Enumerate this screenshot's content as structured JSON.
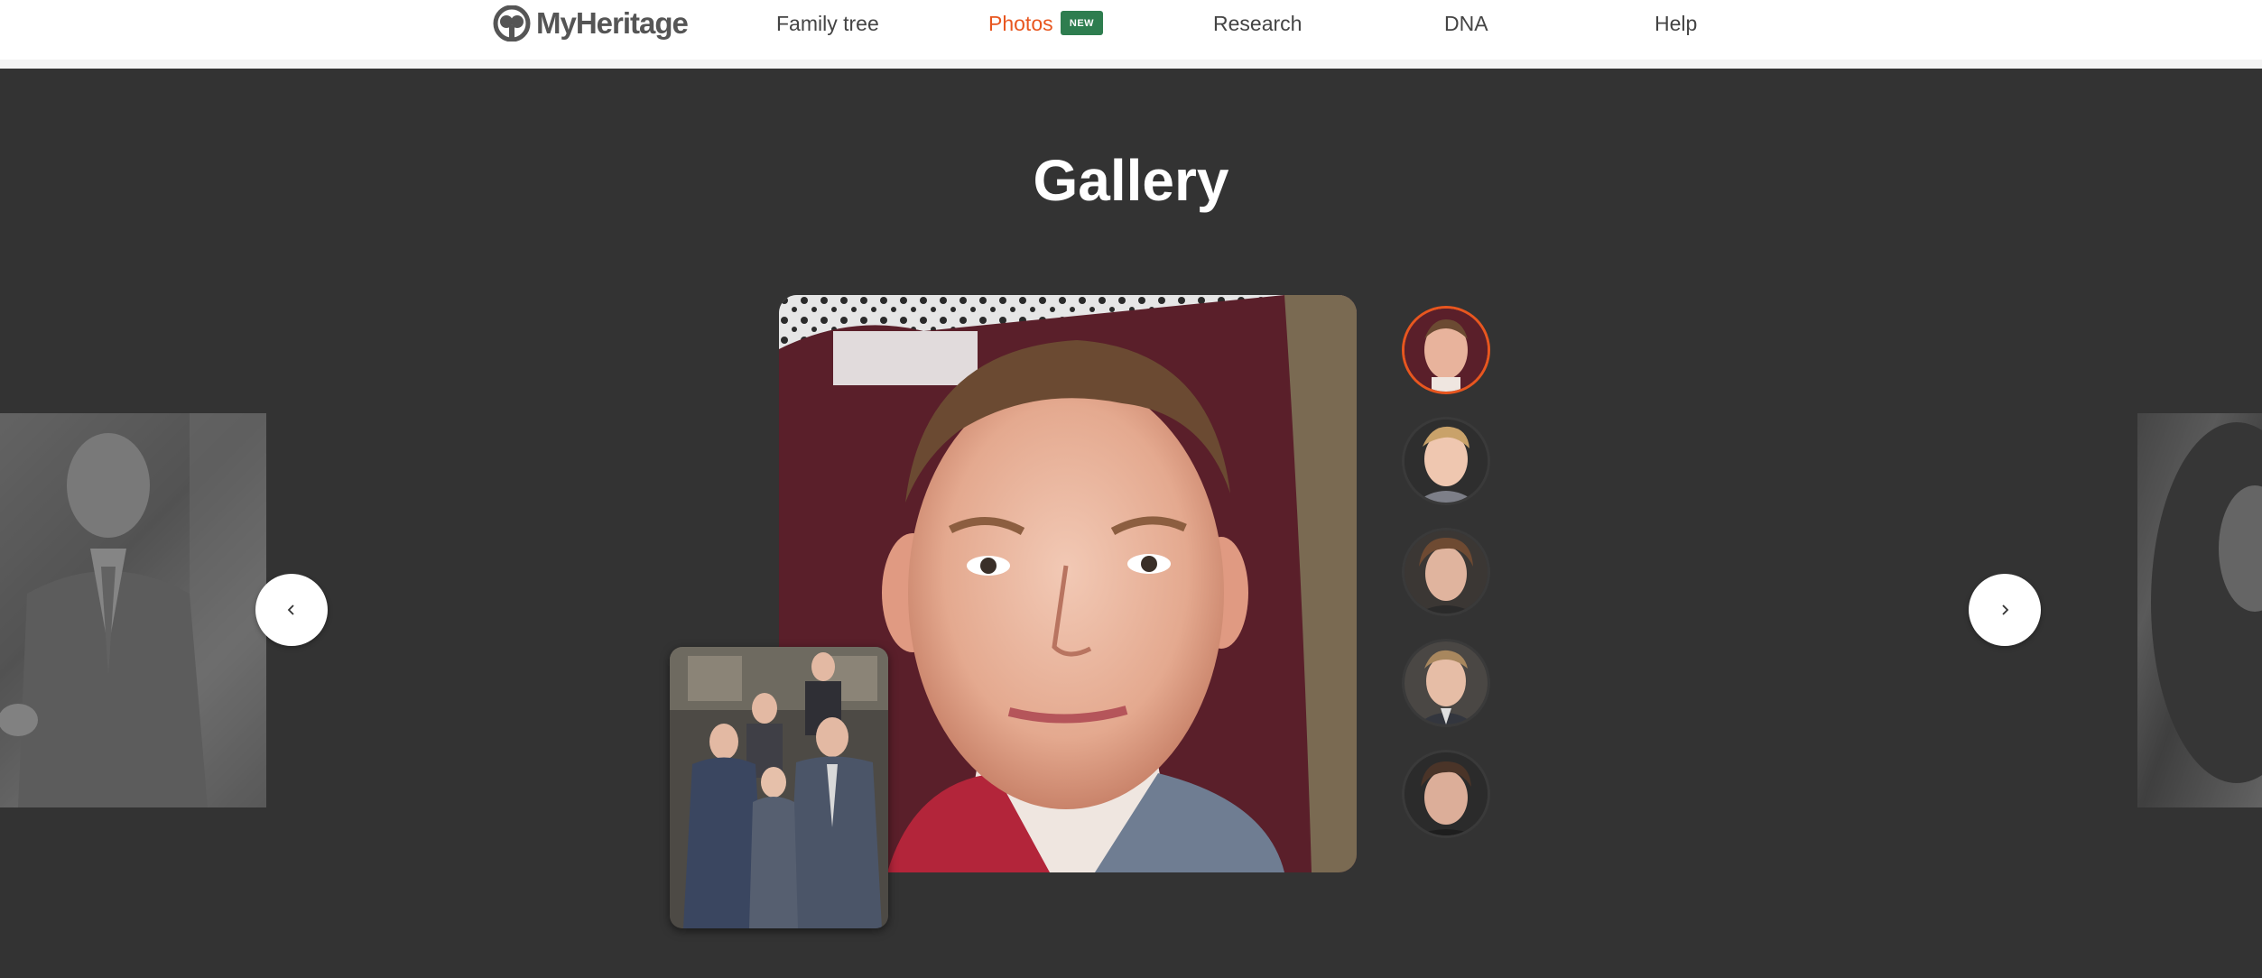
{
  "header": {
    "logo_text": "MyHeritage",
    "nav": [
      {
        "label": "Family tree"
      },
      {
        "label": "Photos",
        "badge": "NEW"
      },
      {
        "label": "Research"
      },
      {
        "label": "DNA"
      },
      {
        "label": "Help"
      }
    ]
  },
  "gallery": {
    "title": "Gallery",
    "selected_index": 0,
    "thumbnails": [
      "portrait-1",
      "portrait-2",
      "portrait-3",
      "portrait-4",
      "portrait-5"
    ]
  },
  "colors": {
    "accent": "#e8561f",
    "badge": "#2e7d4f",
    "background": "#333333"
  },
  "icons": {
    "prev": "chevron-left-icon",
    "next": "chevron-right-icon"
  }
}
